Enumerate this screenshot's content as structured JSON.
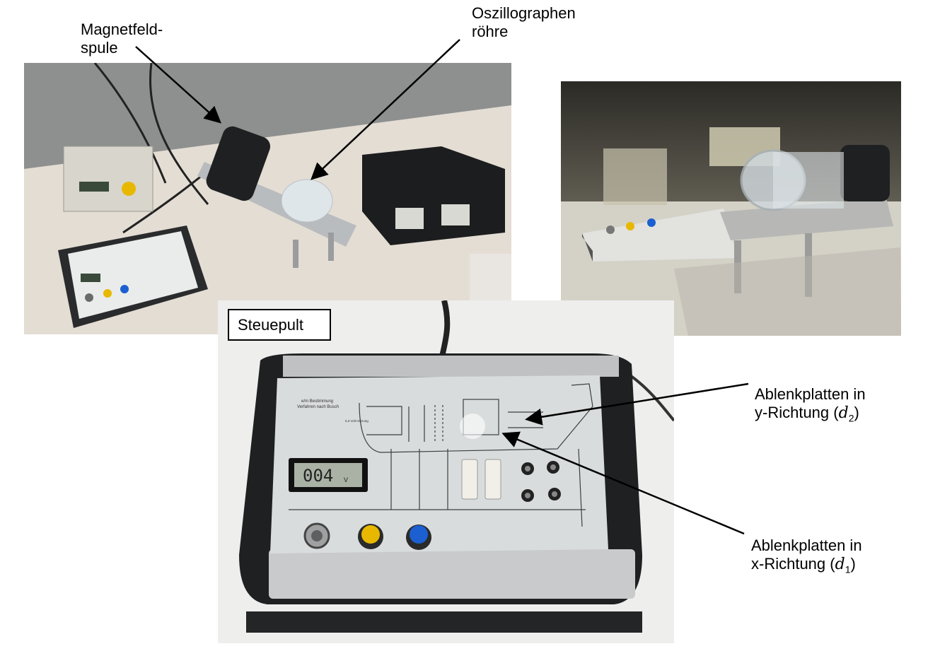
{
  "labels": {
    "magnetfeldspule": "Magnetfeld-\nspule",
    "oszillographenroehre": "Oszillographen\nröhre",
    "steuepult": "Steuepult",
    "ablenk_y": {
      "text": "Ablenkplatten in\ny-Richtung (",
      "var": "d",
      "sub": "2",
      "close": ")"
    },
    "ablenk_x": {
      "text": "Ablenkplatten in\nx-Richtung (",
      "var": "d",
      "sub": "1",
      "close": ")"
    }
  },
  "panel": {
    "title_line1": "e/m Bestimmung",
    "title_line2": "Verfahren nach Busch",
    "heater_label": "6,3 Volt Heizung",
    "display_value": "004",
    "display_unit": "V"
  },
  "colors": {
    "knob_yellow": "#e8b800",
    "knob_blue": "#1b5fd1",
    "display_bg": "#a9b2a4",
    "panel_bg": "#d9dcdc",
    "case_dark": "#1e2022"
  }
}
